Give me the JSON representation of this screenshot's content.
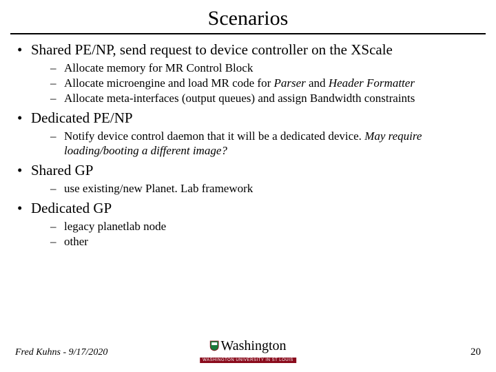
{
  "title": "Scenarios",
  "bullets": [
    {
      "text": "Shared PE/NP, send request to device controller on the XScale",
      "sub": [
        {
          "text": "Allocate memory for MR Control Block"
        },
        {
          "html": "Allocate microengine and load MR code for <span class=\"italic\">Parser</span> and <span class=\"italic\">Header Formatter</span>"
        },
        {
          "text": "Allocate meta-interfaces (output queues) and assign Bandwidth constraints"
        }
      ]
    },
    {
      "text": "Dedicated PE/NP",
      "sub": [
        {
          "html": "Notify device control daemon that it will be a dedicated device. <span class=\"italic\">May require loading/booting a different image?</span>"
        }
      ]
    },
    {
      "text": "Shared GP",
      "sub": [
        {
          "text": "use existing/new Planet. Lab framework"
        }
      ]
    },
    {
      "text": "Dedicated GP",
      "sub": [
        {
          "text": "legacy planetlab node"
        },
        {
          "text": "other"
        }
      ]
    }
  ],
  "footer": {
    "left": "Fred Kuhns - 9/17/2020",
    "center_name": "Washington",
    "center_banner": "WASHINGTON UNIVERSITY IN ST LOUIS",
    "right": "20"
  }
}
